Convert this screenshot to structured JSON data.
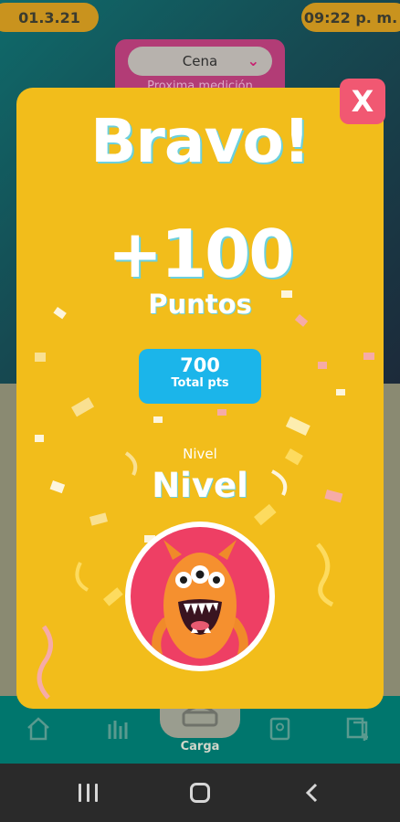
{
  "status_bar": {
    "date": "01.3.21",
    "time": "09:22 p. m."
  },
  "meal_card": {
    "selected": "Cena",
    "next_label": "Proxima medición"
  },
  "modal": {
    "title": "Bravo!",
    "points": "+100",
    "points_label": "Puntos",
    "total_value": "700",
    "total_label": "Total pts",
    "level_caption": "Nivel",
    "level_value": "Nivel",
    "close_symbol": "X"
  },
  "bottom_nav": {
    "items": [
      {
        "icon": "home-icon"
      },
      {
        "icon": "bar-chart-icon"
      },
      {
        "icon": "scale-icon",
        "label": "Carga"
      },
      {
        "icon": "profile-book-icon"
      },
      {
        "icon": "add-copy-icon"
      }
    ]
  },
  "system_nav": {
    "buttons": [
      "recents-icon",
      "home-button-icon",
      "back-icon"
    ]
  },
  "colors": {
    "modal_bg": "#f2bd1b",
    "accent_blue": "#1bb5ea",
    "close_red": "#f15872",
    "avatar_red": "#ee3f64",
    "nav_green": "#00766d"
  }
}
